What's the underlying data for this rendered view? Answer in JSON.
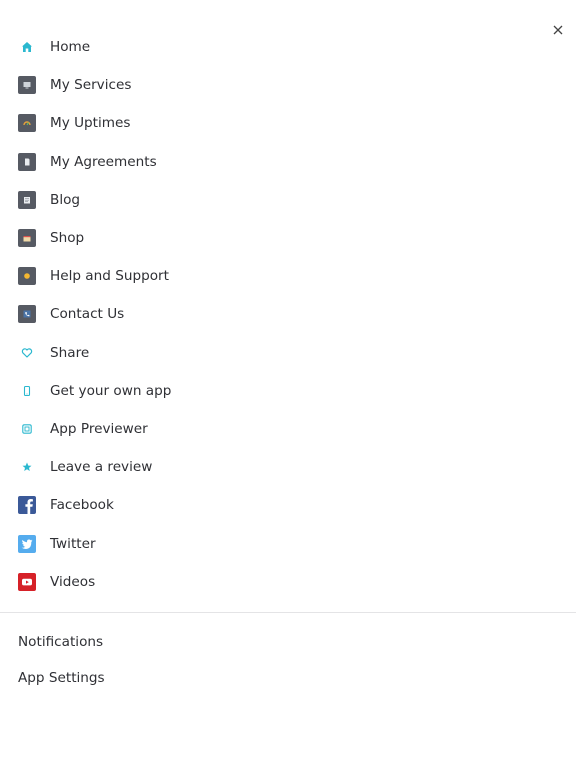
{
  "menu": {
    "items": [
      {
        "label": "Home",
        "icon": "home-icon"
      },
      {
        "label": "My Services",
        "icon": "services-icon"
      },
      {
        "label": "My Uptimes",
        "icon": "uptimes-icon"
      },
      {
        "label": "My Agreements",
        "icon": "agreements-icon"
      },
      {
        "label": "Blog",
        "icon": "blog-icon"
      },
      {
        "label": "Shop",
        "icon": "shop-icon"
      },
      {
        "label": "Help and Support",
        "icon": "help-icon"
      },
      {
        "label": "Contact Us",
        "icon": "contact-icon"
      },
      {
        "label": "Share",
        "icon": "heart-icon"
      },
      {
        "label": "Get your own app",
        "icon": "phone-icon"
      },
      {
        "label": "App Previewer",
        "icon": "previewer-icon"
      },
      {
        "label": "Leave a review",
        "icon": "star-icon"
      },
      {
        "label": "Facebook",
        "icon": "facebook-icon"
      },
      {
        "label": "Twitter",
        "icon": "twitter-icon"
      },
      {
        "label": "Videos",
        "icon": "youtube-icon"
      }
    ]
  },
  "footer": {
    "notifications_label": "Notifications",
    "settings_label": "App Settings"
  },
  "colors": {
    "accent": "#2bb8cf",
    "dark_icon_bg": "#565a63",
    "facebook": "#3b5998",
    "twitter": "#55acee",
    "youtube": "#d62128",
    "text": "#2f3035"
  }
}
